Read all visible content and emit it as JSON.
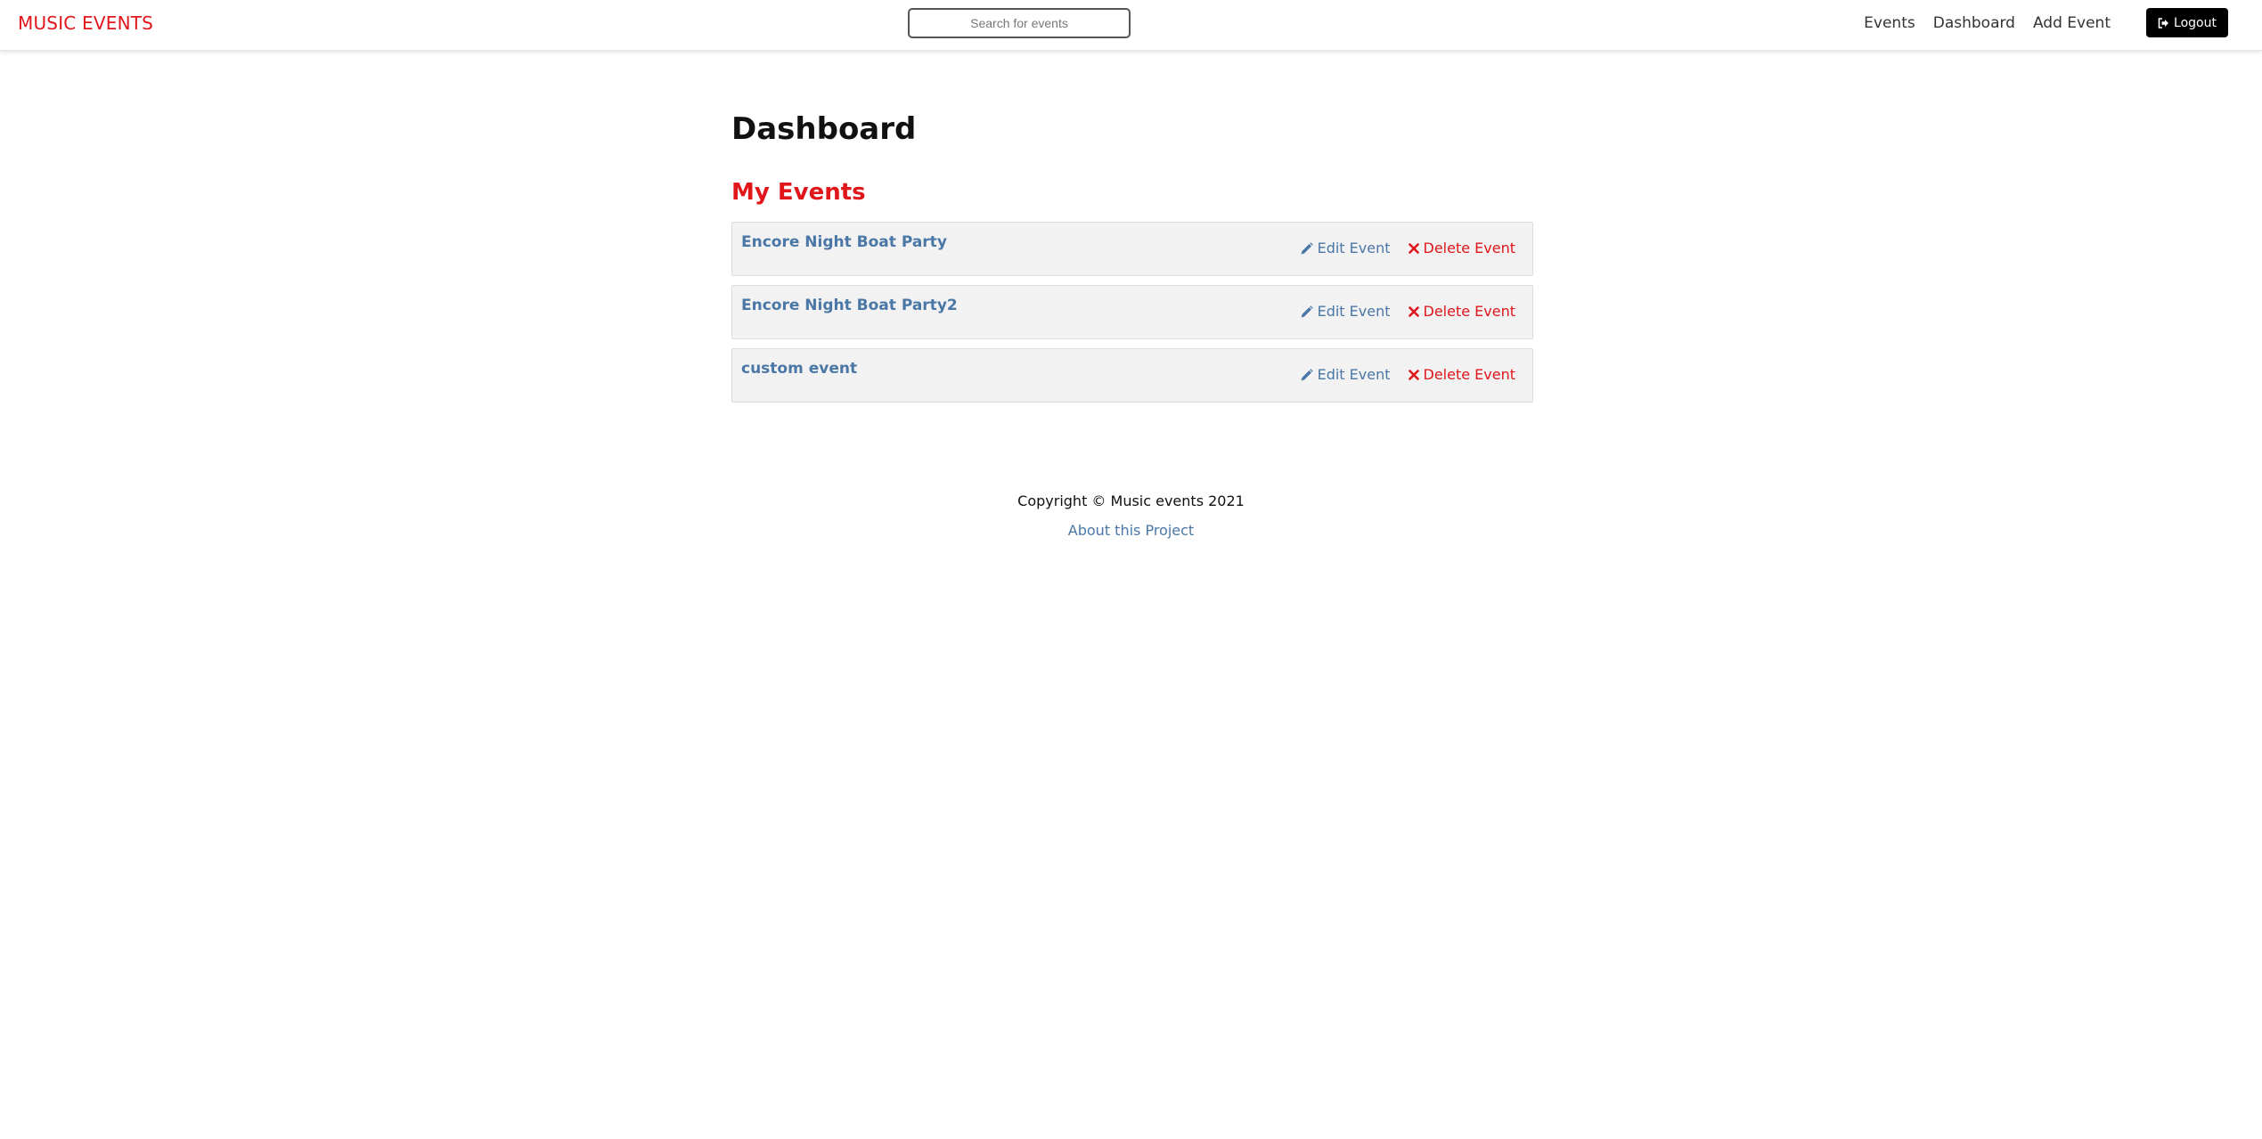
{
  "colors": {
    "brand_red": "#e0161a",
    "link_blue": "#4a77a6",
    "card_bg": "#f2f2f2",
    "logout_bg": "#000000"
  },
  "navbar": {
    "brand": "MUSIC EVENTS",
    "search_placeholder": "Search for events",
    "links": [
      {
        "label": "Events"
      },
      {
        "label": "Dashboard"
      },
      {
        "label": "Add Event"
      }
    ],
    "logout": {
      "label": "Logout",
      "icon": "sign-out-icon"
    }
  },
  "page": {
    "title": "Dashboard",
    "section_title": "My Events"
  },
  "events": [
    {
      "title": "Encore Night Boat Party",
      "edit_label": "Edit Event",
      "edit_icon": "pencil-icon",
      "delete_label": "Delete Event",
      "delete_icon": "close-icon"
    },
    {
      "title": "Encore Night Boat Party2",
      "edit_label": "Edit Event",
      "edit_icon": "pencil-icon",
      "delete_label": "Delete Event",
      "delete_icon": "close-icon"
    },
    {
      "title": "custom event",
      "edit_label": "Edit Event",
      "edit_icon": "pencil-icon",
      "delete_label": "Delete Event",
      "delete_icon": "close-icon"
    }
  ],
  "footer": {
    "copyright": "Copyright © Music events 2021",
    "about_link": "About this Project"
  }
}
